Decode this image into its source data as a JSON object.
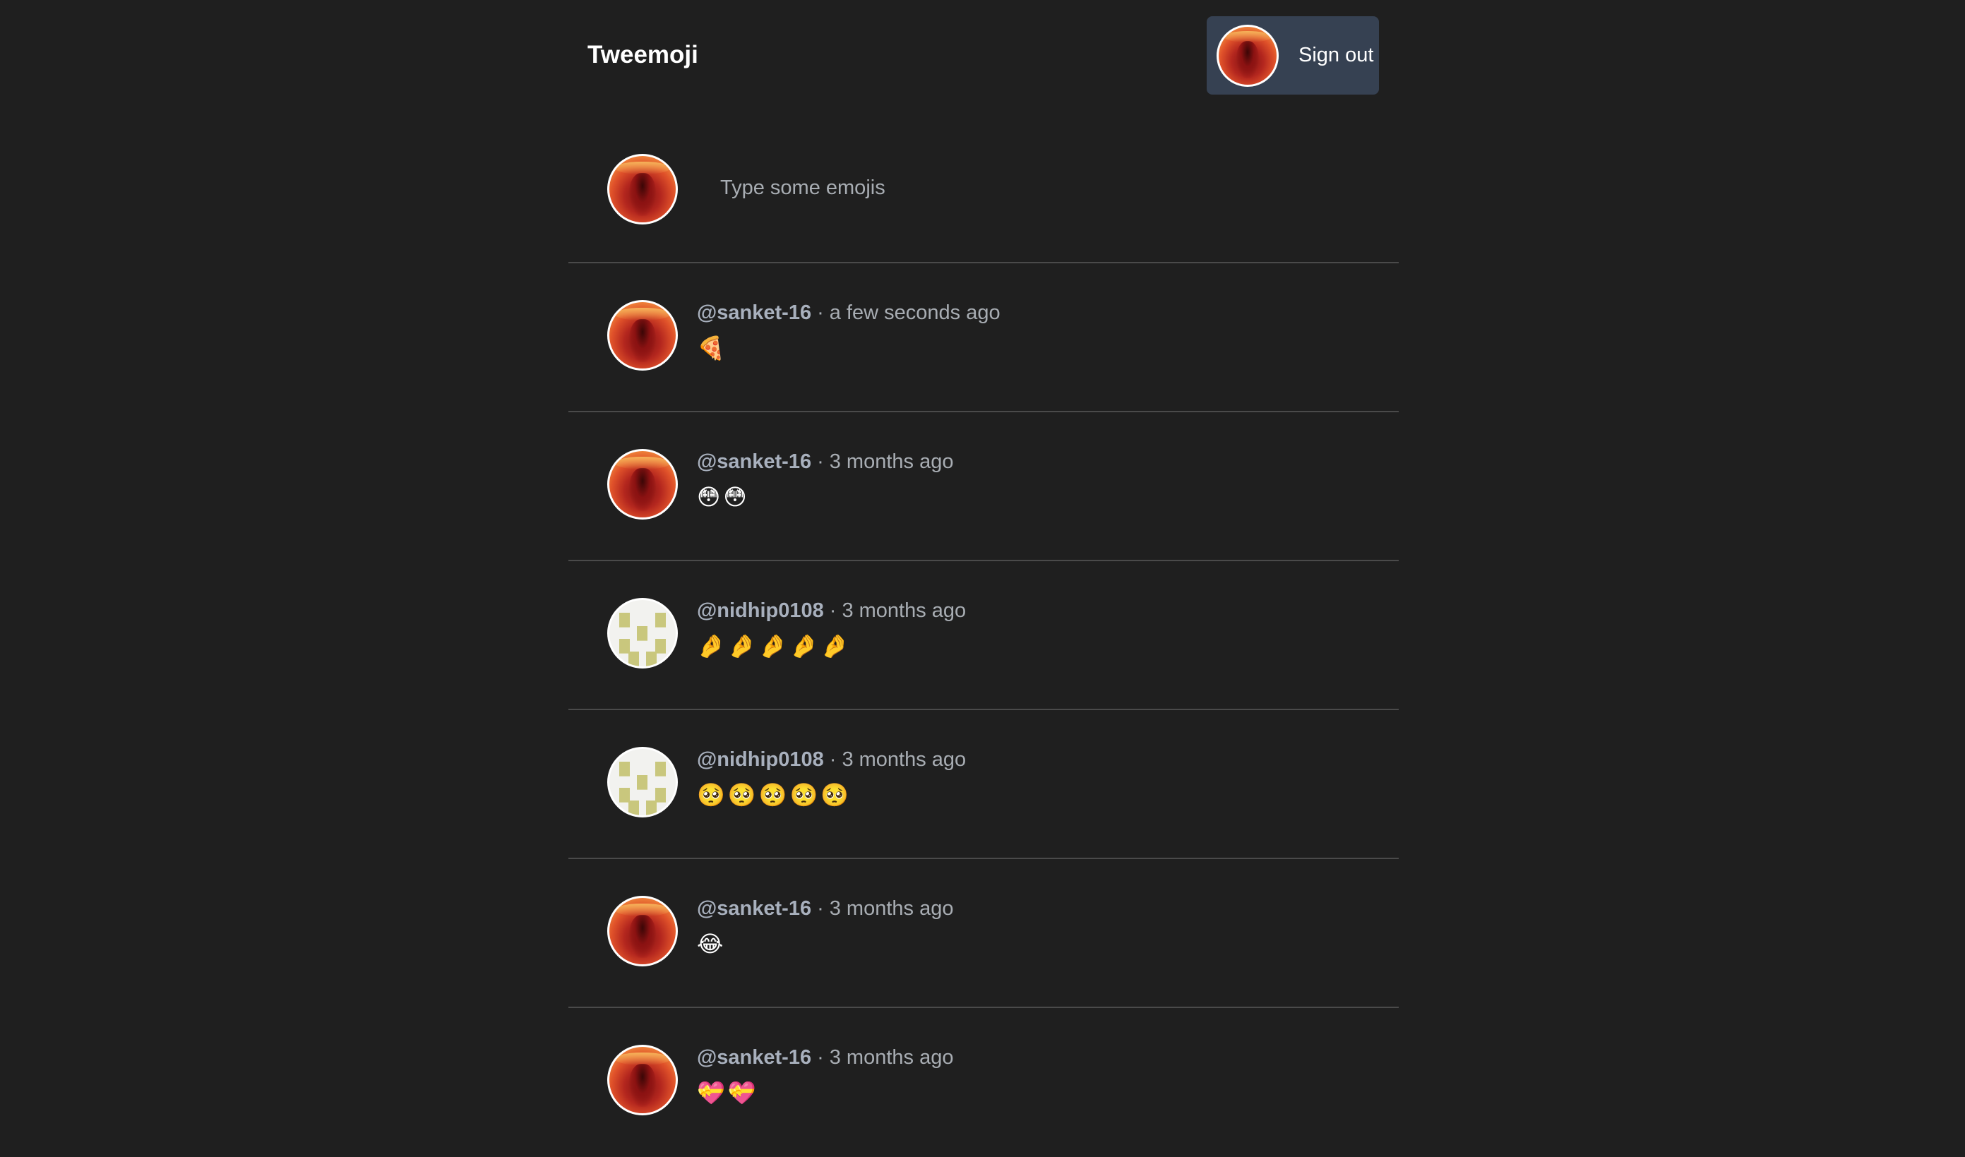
{
  "header": {
    "brand": "Tweemoji",
    "signout_label": "Sign out"
  },
  "compose": {
    "placeholder": "Type some emojis"
  },
  "posts": [
    {
      "user": "@sanket-16",
      "time": "a few seconds ago",
      "content": "🍕",
      "avatar": "fire-avatar"
    },
    {
      "user": "@sanket-16",
      "time": "3 months ago",
      "content": "😳😳",
      "avatar": "fire-avatar"
    },
    {
      "user": "@nidhip0108",
      "time": "3 months ago",
      "content": "🤌🤌🤌🤌🤌",
      "avatar": "pixel-avatar"
    },
    {
      "user": "@nidhip0108",
      "time": "3 months ago",
      "content": "🥺🥺🥺🥺🥺",
      "avatar": "pixel-avatar"
    },
    {
      "user": "@sanket-16",
      "time": "3 months ago",
      "content": "😂",
      "avatar": "fire-avatar"
    },
    {
      "user": "@sanket-16",
      "time": "3 months ago",
      "content": "💝💝",
      "avatar": "fire-avatar"
    }
  ],
  "separator": "·"
}
